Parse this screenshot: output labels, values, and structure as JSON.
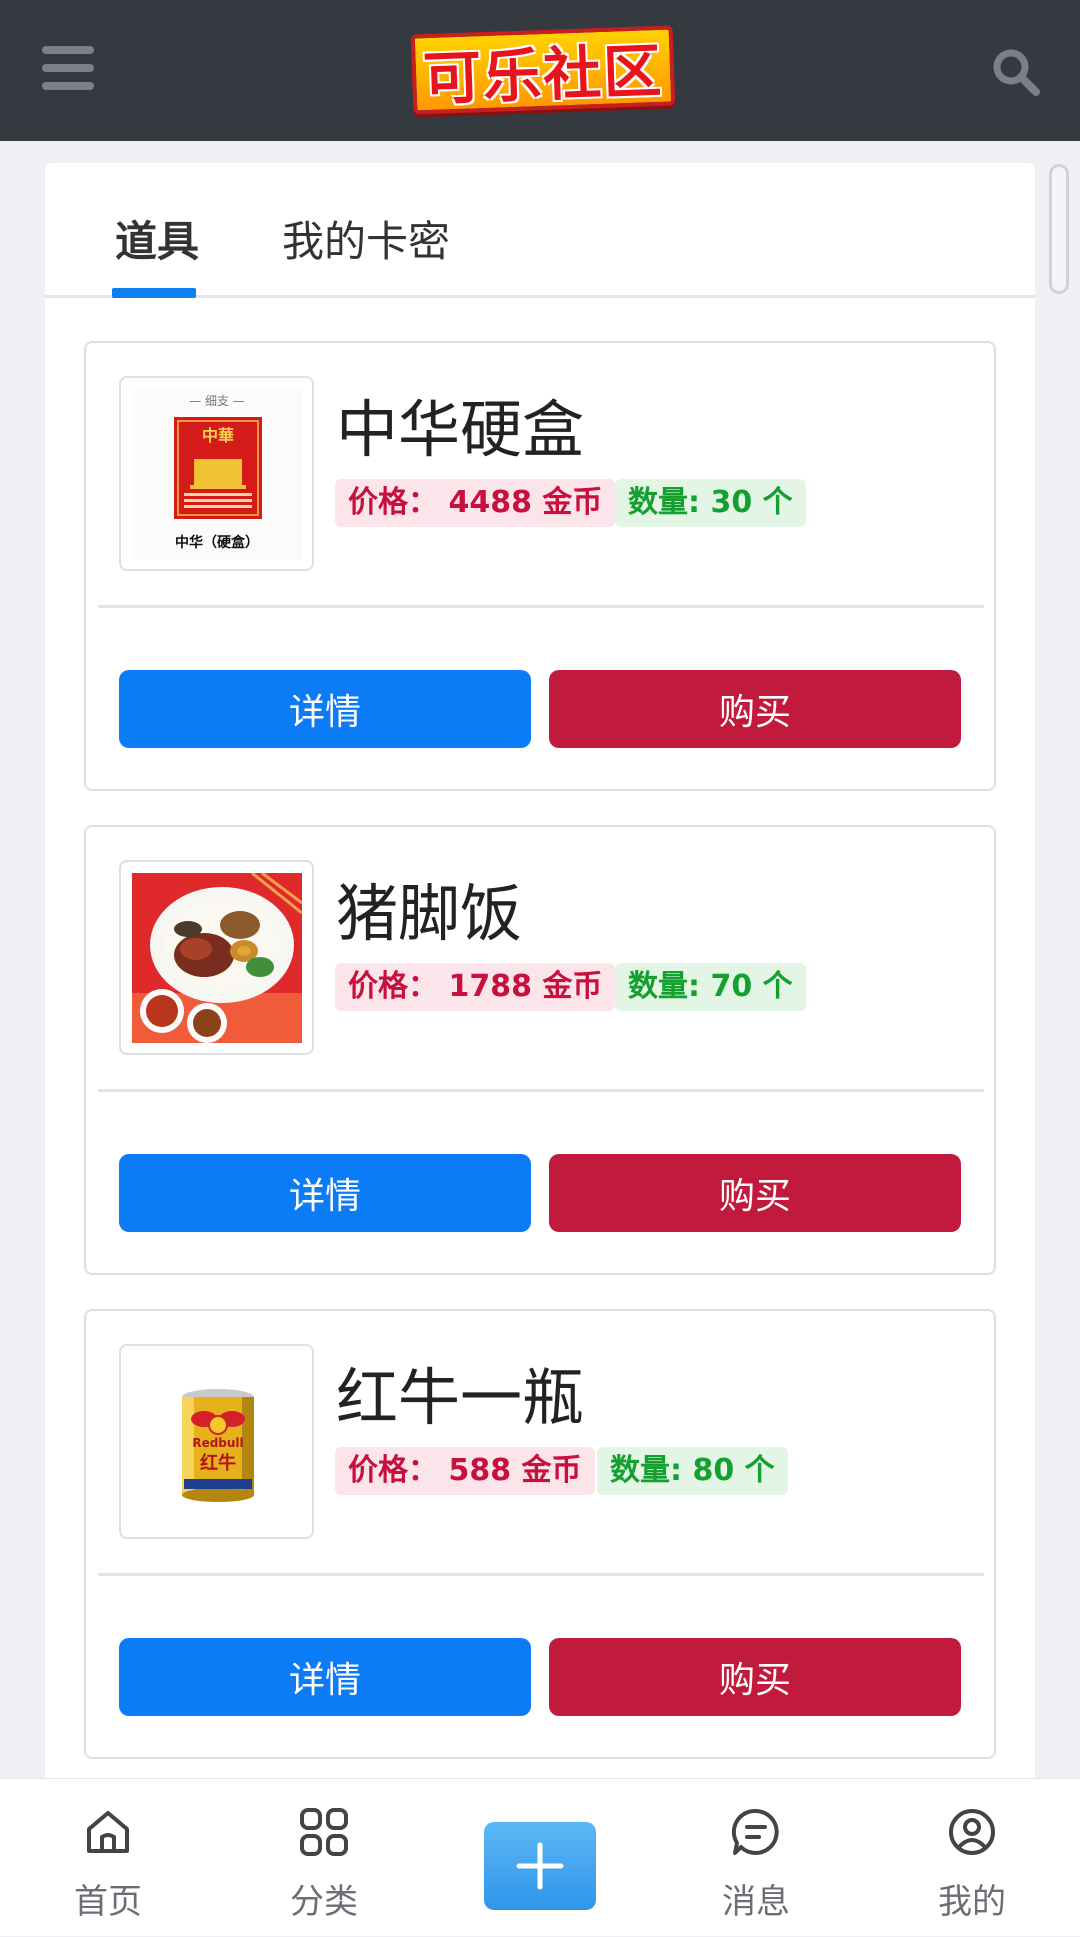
{
  "header": {
    "logo_text": "可乐社区",
    "menu_icon": "hamburger-menu-icon",
    "search_icon": "search-icon"
  },
  "tabs": [
    {
      "label": "道具",
      "active": true
    },
    {
      "label": "我的卡密",
      "active": false
    }
  ],
  "items": [
    {
      "name": "中华硬盒",
      "price_label": "价格： 4488 金币",
      "stock_label": "数量:   30 个",
      "image": "zhonghua-cigarette-pack",
      "image_top_text": "— 细支 —",
      "image_brand_text": "中華",
      "image_caption": "中华（硬盒）",
      "detail_label": "详情",
      "buy_label": "购买"
    },
    {
      "name": "猪脚饭",
      "price_label": "价格： 1788 金币",
      "stock_label": "数量:   70 个",
      "image": "pork-knuckle-rice-plate",
      "detail_label": "详情",
      "buy_label": "购买"
    },
    {
      "name": "红牛一瓶",
      "price_label": "价格： 588 金币",
      "stock_label": "数量:   80 个",
      "image": "red-bull-can",
      "image_brand_text": "Redbull",
      "image_can_text": "红牛",
      "detail_label": "详情",
      "buy_label": "购买"
    }
  ],
  "bottom_nav": [
    {
      "label": "首页",
      "icon": "home-icon"
    },
    {
      "label": "分类",
      "icon": "grid-icon"
    },
    {
      "label": "",
      "icon": "plus-icon"
    },
    {
      "label": "消息",
      "icon": "message-icon"
    },
    {
      "label": "我的",
      "icon": "user-icon"
    }
  ],
  "colors": {
    "header_bg": "#343a40",
    "accent_blue": "#0b7cf5",
    "buy_red": "#c21a3c",
    "price_text": "#c8103e",
    "stock_text": "#14a02e"
  }
}
